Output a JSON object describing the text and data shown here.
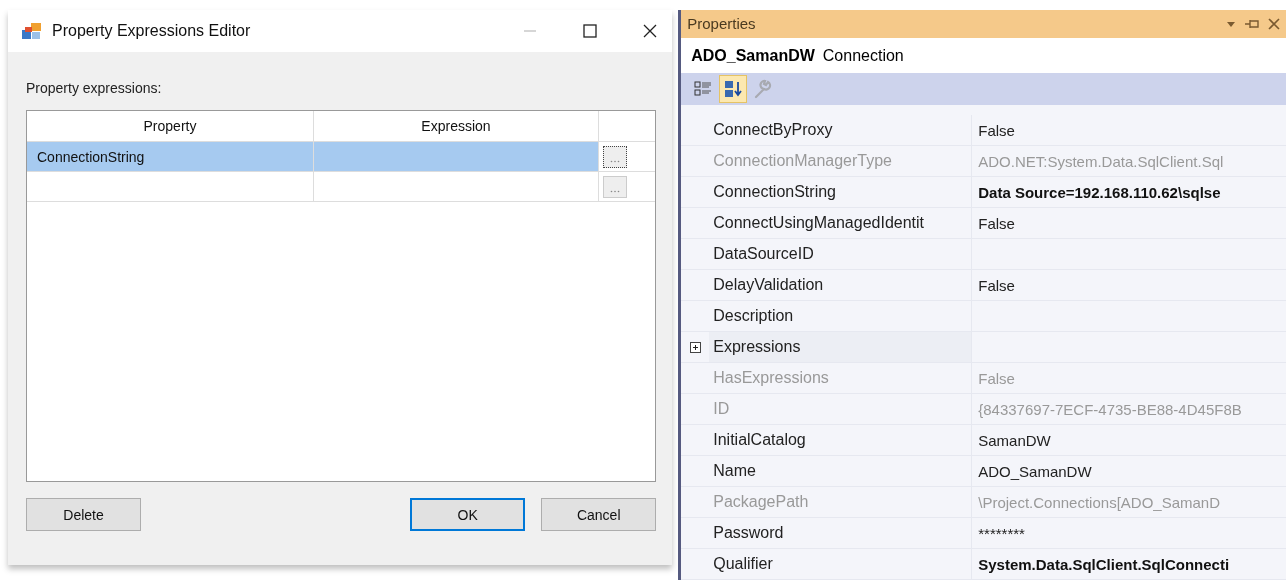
{
  "dialog": {
    "title": "Property Expressions Editor",
    "label": "Property expressions:",
    "grid": {
      "columns": [
        "Property",
        "Expression"
      ],
      "rows": [
        {
          "property": "ConnectionString",
          "selected": true
        },
        {
          "selected": false
        }
      ]
    },
    "buttons": [
      {
        "label": "Delete",
        "default": false
      },
      {
        "label": "OK",
        "default": true
      },
      {
        "label": "Cancel",
        "default": false
      }
    ]
  },
  "properties": {
    "title": "Properties",
    "object_name": "ADO_SamanDW",
    "object_type": "Connection",
    "toolbar": [
      {
        "kind": "categorized",
        "selected": false,
        "disabled": false
      },
      {
        "kind": "alphabetical",
        "selected": true,
        "disabled": false
      },
      {
        "kind": "pages",
        "selected": false,
        "disabled": true
      }
    ],
    "rows": [
      {
        "kind": "property",
        "name": "ConnectByProxy",
        "value": "False",
        "disabled": false
      },
      {
        "kind": "property",
        "name": "ConnectionManagerType",
        "value": "ADO.NET:System.Data.SqlClient.Sql",
        "disabled": true
      },
      {
        "kind": "property",
        "name": "ConnectionString",
        "value": "Data Source=192.168.110.62\\sqlse",
        "disabled": false,
        "bold": true
      },
      {
        "kind": "property",
        "name": "ConnectUsingManagedIdentit",
        "value": "False",
        "disabled": false
      },
      {
        "kind": "property",
        "name": "DataSourceID",
        "disabled": false
      },
      {
        "kind": "property",
        "name": "DelayValidation",
        "value": "False",
        "disabled": false
      },
      {
        "kind": "property",
        "name": "Description",
        "disabled": false
      },
      {
        "kind": "group",
        "name": "Expressions",
        "expanded": false
      },
      {
        "kind": "property",
        "name": "HasExpressions",
        "value": "False",
        "disabled": true
      },
      {
        "kind": "property",
        "name": "ID",
        "value": "{84337697-7ECF-4735-BE88-4D45F8B",
        "disabled": true
      },
      {
        "kind": "property",
        "name": "InitialCatalog",
        "value": "SamanDW",
        "disabled": false
      },
      {
        "kind": "property",
        "name": "Name",
        "value": "ADO_SamanDW",
        "disabled": false
      },
      {
        "kind": "property",
        "name": "PackagePath",
        "value": "\\Project.Connections[ADO_SamanD",
        "disabled": true
      },
      {
        "kind": "property",
        "name": "Password",
        "value": "********",
        "disabled": false
      },
      {
        "kind": "property",
        "name": "Qualifier",
        "value": "System.Data.SqlClient.SqlConnecti",
        "disabled": false,
        "bold": true
      }
    ]
  }
}
